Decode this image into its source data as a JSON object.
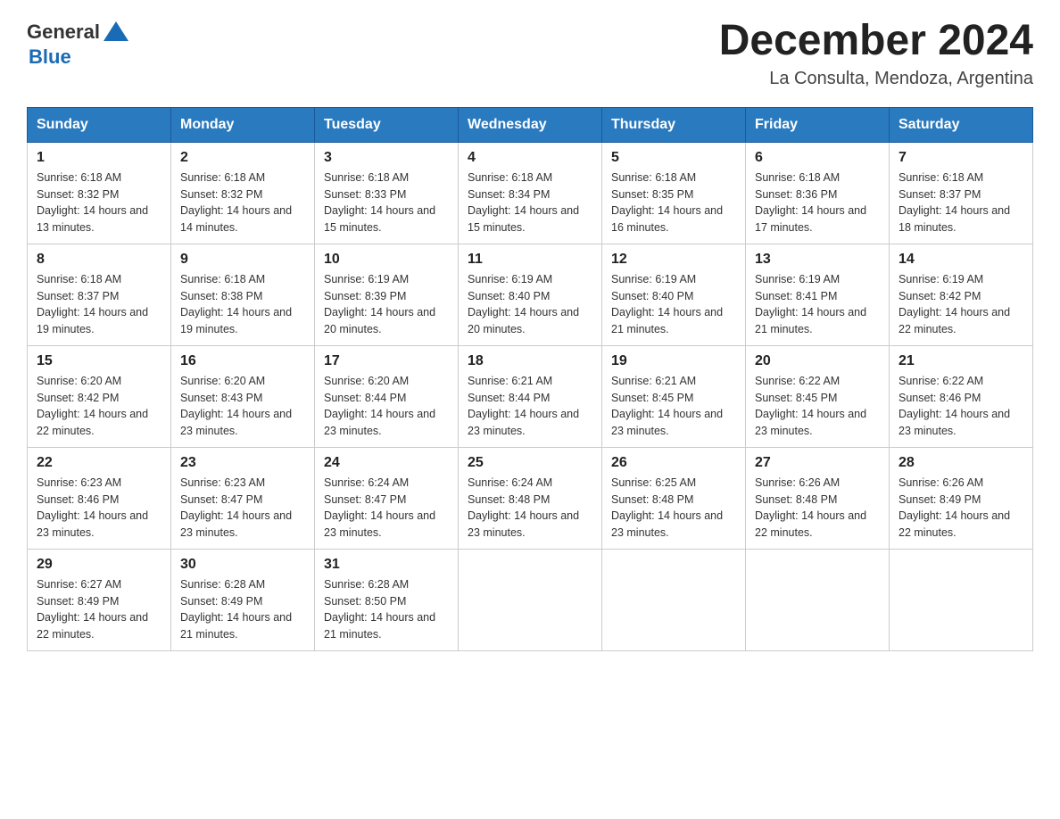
{
  "logo": {
    "text_general": "General",
    "text_blue": "Blue"
  },
  "title": "December 2024",
  "subtitle": "La Consulta, Mendoza, Argentina",
  "weekdays": [
    "Sunday",
    "Monday",
    "Tuesday",
    "Wednesday",
    "Thursday",
    "Friday",
    "Saturday"
  ],
  "weeks": [
    [
      {
        "day": "1",
        "sunrise": "6:18 AM",
        "sunset": "8:32 PM",
        "daylight": "14 hours and 13 minutes."
      },
      {
        "day": "2",
        "sunrise": "6:18 AM",
        "sunset": "8:32 PM",
        "daylight": "14 hours and 14 minutes."
      },
      {
        "day": "3",
        "sunrise": "6:18 AM",
        "sunset": "8:33 PM",
        "daylight": "14 hours and 15 minutes."
      },
      {
        "day": "4",
        "sunrise": "6:18 AM",
        "sunset": "8:34 PM",
        "daylight": "14 hours and 15 minutes."
      },
      {
        "day": "5",
        "sunrise": "6:18 AM",
        "sunset": "8:35 PM",
        "daylight": "14 hours and 16 minutes."
      },
      {
        "day": "6",
        "sunrise": "6:18 AM",
        "sunset": "8:36 PM",
        "daylight": "14 hours and 17 minutes."
      },
      {
        "day": "7",
        "sunrise": "6:18 AM",
        "sunset": "8:37 PM",
        "daylight": "14 hours and 18 minutes."
      }
    ],
    [
      {
        "day": "8",
        "sunrise": "6:18 AM",
        "sunset": "8:37 PM",
        "daylight": "14 hours and 19 minutes."
      },
      {
        "day": "9",
        "sunrise": "6:18 AM",
        "sunset": "8:38 PM",
        "daylight": "14 hours and 19 minutes."
      },
      {
        "day": "10",
        "sunrise": "6:19 AM",
        "sunset": "8:39 PM",
        "daylight": "14 hours and 20 minutes."
      },
      {
        "day": "11",
        "sunrise": "6:19 AM",
        "sunset": "8:40 PM",
        "daylight": "14 hours and 20 minutes."
      },
      {
        "day": "12",
        "sunrise": "6:19 AM",
        "sunset": "8:40 PM",
        "daylight": "14 hours and 21 minutes."
      },
      {
        "day": "13",
        "sunrise": "6:19 AM",
        "sunset": "8:41 PM",
        "daylight": "14 hours and 21 minutes."
      },
      {
        "day": "14",
        "sunrise": "6:19 AM",
        "sunset": "8:42 PM",
        "daylight": "14 hours and 22 minutes."
      }
    ],
    [
      {
        "day": "15",
        "sunrise": "6:20 AM",
        "sunset": "8:42 PM",
        "daylight": "14 hours and 22 minutes."
      },
      {
        "day": "16",
        "sunrise": "6:20 AM",
        "sunset": "8:43 PM",
        "daylight": "14 hours and 23 minutes."
      },
      {
        "day": "17",
        "sunrise": "6:20 AM",
        "sunset": "8:44 PM",
        "daylight": "14 hours and 23 minutes."
      },
      {
        "day": "18",
        "sunrise": "6:21 AM",
        "sunset": "8:44 PM",
        "daylight": "14 hours and 23 minutes."
      },
      {
        "day": "19",
        "sunrise": "6:21 AM",
        "sunset": "8:45 PM",
        "daylight": "14 hours and 23 minutes."
      },
      {
        "day": "20",
        "sunrise": "6:22 AM",
        "sunset": "8:45 PM",
        "daylight": "14 hours and 23 minutes."
      },
      {
        "day": "21",
        "sunrise": "6:22 AM",
        "sunset": "8:46 PM",
        "daylight": "14 hours and 23 minutes."
      }
    ],
    [
      {
        "day": "22",
        "sunrise": "6:23 AM",
        "sunset": "8:46 PM",
        "daylight": "14 hours and 23 minutes."
      },
      {
        "day": "23",
        "sunrise": "6:23 AM",
        "sunset": "8:47 PM",
        "daylight": "14 hours and 23 minutes."
      },
      {
        "day": "24",
        "sunrise": "6:24 AM",
        "sunset": "8:47 PM",
        "daylight": "14 hours and 23 minutes."
      },
      {
        "day": "25",
        "sunrise": "6:24 AM",
        "sunset": "8:48 PM",
        "daylight": "14 hours and 23 minutes."
      },
      {
        "day": "26",
        "sunrise": "6:25 AM",
        "sunset": "8:48 PM",
        "daylight": "14 hours and 23 minutes."
      },
      {
        "day": "27",
        "sunrise": "6:26 AM",
        "sunset": "8:48 PM",
        "daylight": "14 hours and 22 minutes."
      },
      {
        "day": "28",
        "sunrise": "6:26 AM",
        "sunset": "8:49 PM",
        "daylight": "14 hours and 22 minutes."
      }
    ],
    [
      {
        "day": "29",
        "sunrise": "6:27 AM",
        "sunset": "8:49 PM",
        "daylight": "14 hours and 22 minutes."
      },
      {
        "day": "30",
        "sunrise": "6:28 AM",
        "sunset": "8:49 PM",
        "daylight": "14 hours and 21 minutes."
      },
      {
        "day": "31",
        "sunrise": "6:28 AM",
        "sunset": "8:50 PM",
        "daylight": "14 hours and 21 minutes."
      },
      null,
      null,
      null,
      null
    ]
  ]
}
